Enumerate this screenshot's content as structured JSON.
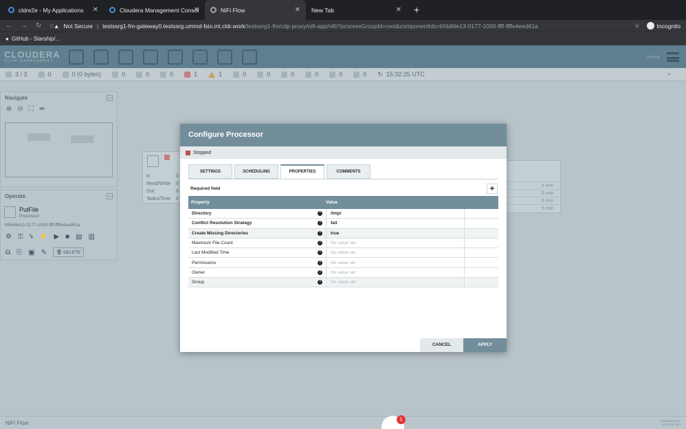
{
  "browser": {
    "tabs": [
      {
        "title": "cldre2e - My Applications"
      },
      {
        "title": "Cloudera Management Consol"
      },
      {
        "title": "NiFi Flow"
      },
      {
        "title": "New Tab"
      }
    ],
    "security_label": "Not Secure",
    "url_host": "testssrg1-fm-gateway0.testssrg.ummd-fsio.int.cldr.work",
    "url_path": "/testssrg1-fm/cdp-proxy/nifi-app/nifi/?processGroupId=root&componentIds=b5b66e13-0177-1000-ffff-ffffe4eed61a",
    "mode_label": "Incognito",
    "bookmark": "GitHub - Starship/..."
  },
  "nifi": {
    "logo_line1": "CLOUDERA",
    "logo_line2": "FLOW MANAGEMENT",
    "user": "veena",
    "status": {
      "nodes": "3 / 3",
      "threads": "0",
      "queued": "0 (0 bytes)",
      "transmitting": "0",
      "not_transmitting": "0",
      "running": "0",
      "stopped": "1",
      "invalid": "1",
      "disabled": "0",
      "up_to_date": "0",
      "locally_modified": "0",
      "stale": "0",
      "errors": "0",
      "sync_failure": "0",
      "refreshed": "15:32:25 UTC"
    },
    "navigate_title": "Navigate",
    "operate": {
      "title": "Operate",
      "component_name": "PutFile",
      "component_type": "Processor",
      "component_id": "b5b66e13-0177-1000-ffff-ffffe4eed61a",
      "delete_label": "DELETE"
    },
    "processor_stats": [
      "In",
      "Read/Write",
      "Out",
      "Tasks/Time"
    ],
    "processor_values": [
      "0",
      "0",
      "0",
      "0"
    ],
    "conn_rows": [
      "5 min",
      "5 min",
      "5 min",
      "5 min"
    ],
    "footer": "NiFi Flow",
    "powered_1": "POWERED BY",
    "powered_2": "APACHE NIFI",
    "notification_count": "1"
  },
  "dialog": {
    "title": "Configure Processor",
    "state": "Stopped",
    "tabs": [
      "SETTINGS",
      "SCHEDULING",
      "PROPERTIES",
      "COMMENTS"
    ],
    "required_label": "Required field",
    "columns": [
      "Property",
      "Value"
    ],
    "properties": [
      {
        "name": "Directory",
        "value": "/tmp/"
      },
      {
        "name": "Conflict Resolution Strategy",
        "value": "fail"
      },
      {
        "name": "Create Missing Directories",
        "value": "true"
      },
      {
        "name": "Maximum File Count",
        "value": "No value set"
      },
      {
        "name": "Last Modified Time",
        "value": "No value set"
      },
      {
        "name": "Permissions",
        "value": "No value set"
      },
      {
        "name": "Owner",
        "value": "No value set"
      },
      {
        "name": "Group",
        "value": "No value set"
      }
    ],
    "cancel_label": "CANCEL",
    "apply_label": "APPLY"
  }
}
